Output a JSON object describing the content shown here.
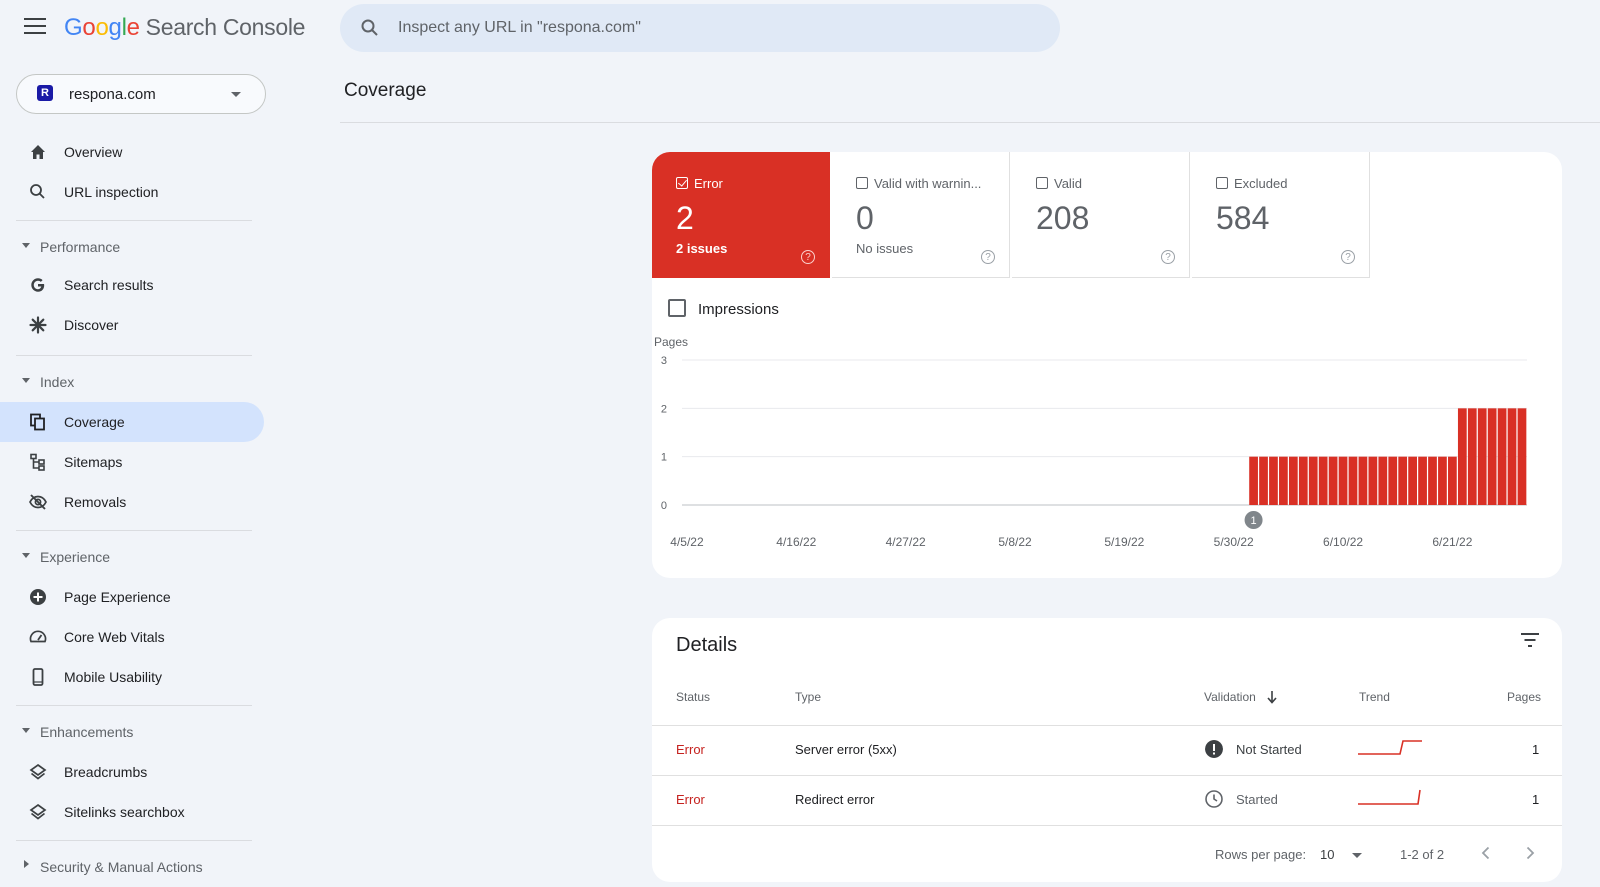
{
  "app": {
    "logo_letters": [
      "G",
      "o",
      "o",
      "g",
      "l",
      "e"
    ],
    "product": "Search Console",
    "search_placeholder": "Inspect any URL in \"respona.com\""
  },
  "property": {
    "badge": "R",
    "name": "respona.com"
  },
  "sidebar": {
    "overview": "Overview",
    "url_inspection": "URL inspection",
    "performance": "Performance",
    "search_results": "Search results",
    "discover": "Discover",
    "index": "Index",
    "coverage": "Coverage",
    "sitemaps": "Sitemaps",
    "removals": "Removals",
    "experience": "Experience",
    "page_experience": "Page Experience",
    "core_web_vitals": "Core Web Vitals",
    "mobile_usability": "Mobile Usability",
    "enhancements": "Enhancements",
    "breadcrumbs": "Breadcrumbs",
    "sitelinks_searchbox": "Sitelinks searchbox",
    "security": "Security & Manual Actions"
  },
  "page_title": "Coverage",
  "tiles": [
    {
      "label": "Error",
      "value": "2",
      "sub": "2 issues",
      "checked": true
    },
    {
      "label": "Valid with warnin...",
      "value": "0",
      "sub": "No issues",
      "checked": false
    },
    {
      "label": "Valid",
      "value": "208",
      "sub": "",
      "checked": false
    },
    {
      "label": "Excluded",
      "value": "584",
      "sub": "",
      "checked": false
    }
  ],
  "impressions_label": "Impressions",
  "chart_data": {
    "type": "bar",
    "ylabel": "Pages",
    "ylim": [
      0,
      3
    ],
    "yticks": [
      0,
      1,
      2,
      3
    ],
    "xtick_labels": [
      "4/5/22",
      "4/16/22",
      "4/27/22",
      "5/8/22",
      "5/19/22",
      "5/30/22",
      "6/10/22",
      "6/21/22"
    ],
    "x_start": "4/5/22",
    "x_end": "6/27/22",
    "series": [
      {
        "color": "#d93025",
        "values": [
          0,
          0,
          0,
          0,
          0,
          0,
          0,
          0,
          0,
          0,
          0,
          0,
          0,
          0,
          0,
          0,
          0,
          0,
          0,
          0,
          0,
          0,
          0,
          0,
          0,
          0,
          0,
          0,
          0,
          0,
          0,
          0,
          0,
          0,
          0,
          0,
          0,
          0,
          0,
          0,
          0,
          0,
          0,
          0,
          0,
          0,
          0,
          0,
          0,
          0,
          0,
          0,
          0,
          0,
          0,
          0,
          0,
          1,
          1,
          1,
          1,
          1,
          1,
          1,
          1,
          1,
          1,
          1,
          1,
          1,
          1,
          1,
          1,
          1,
          1,
          1,
          1,
          1,
          2,
          2,
          2,
          2,
          2,
          2,
          2
        ]
      }
    ],
    "annotation": {
      "label": "1",
      "date": "6/1/22"
    },
    "grid": true
  },
  "details": {
    "title": "Details",
    "columns": {
      "status": "Status",
      "type": "Type",
      "validation": "Validation",
      "trend": "Trend",
      "pages": "Pages"
    },
    "rows": [
      {
        "status": "Error",
        "type": "Server error (5xx)",
        "validation": "Not Started",
        "validation_icon": "exclamation-icon",
        "pages": "1"
      },
      {
        "status": "Error",
        "type": "Redirect error",
        "validation": "Started",
        "validation_icon": "clock-icon",
        "pages": "1"
      }
    ],
    "footer": {
      "rows_per_page_label": "Rows per page:",
      "rows_per_page": "10",
      "range": "1-2 of 2"
    }
  },
  "colors": {
    "error": "#d93025",
    "active_nav": "#d3e3fd",
    "background": "#f1f4f9"
  }
}
